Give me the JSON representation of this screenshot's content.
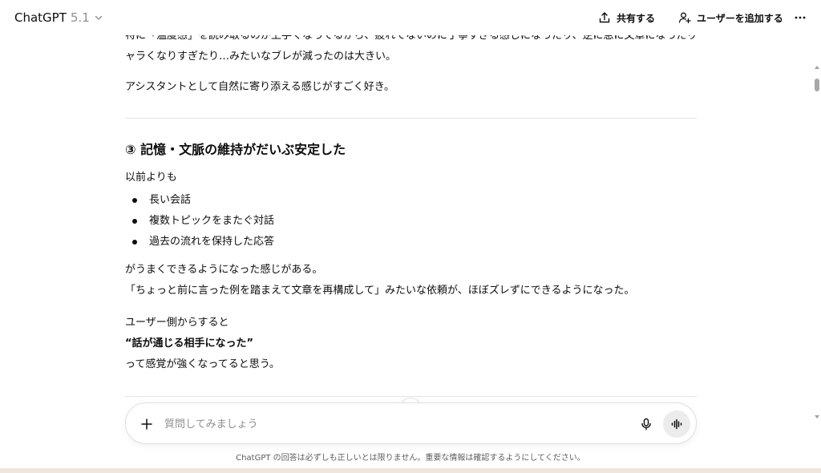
{
  "header": {
    "model_name": "ChatGPT",
    "model_version": "5.1",
    "share_label": "共有する",
    "add_user_label": "ユーザーを追加する"
  },
  "message": {
    "cut_line_1": "特に「温度感」を読み取るのが上手くなってるから、疲れてないのに丁寧すぎる感じになったり、逆に急に文章になったり、逆にフ",
    "cut_line_2": "ャラくなりすぎたり…みたいなブレが減ったのは大きい。",
    "assistant_para": "アシスタントとして自然に寄り添える感じがすごく好き。",
    "section_heading": "③ 記憶・文脈の維持がだいぶ安定した",
    "intro": "以前よりも",
    "bullets": [
      "長い会話",
      "複数トピックをまたぐ対話",
      "過去の流れを保持した応答"
    ],
    "result_1": "がうまくできるようになった感じがある。",
    "result_2": "「ちょっと前に言った例を踏まえて文章を再構成して」みたいな依頼が、ほぼズレずにできるようになった。",
    "user_side_1": "ユーザー側からすると",
    "user_side_2": "“話が通じる相手になった”",
    "user_side_3": "って感覚が強くなってると思う。"
  },
  "composer": {
    "placeholder": "質問してみましょう",
    "value": ""
  },
  "disclaimer": "ChatGPT の回答は必ずしも正しいとは限りません。重要な情報は確認するようにしてください。",
  "icons": {
    "share": "share-icon",
    "add_user": "add-user-icon",
    "more": "more-icon",
    "chevron": "chevron-down-icon",
    "scroll_down": "arrow-down-icon",
    "plus": "plus-icon",
    "mic": "mic-icon",
    "voice": "voice-mode-icon"
  }
}
